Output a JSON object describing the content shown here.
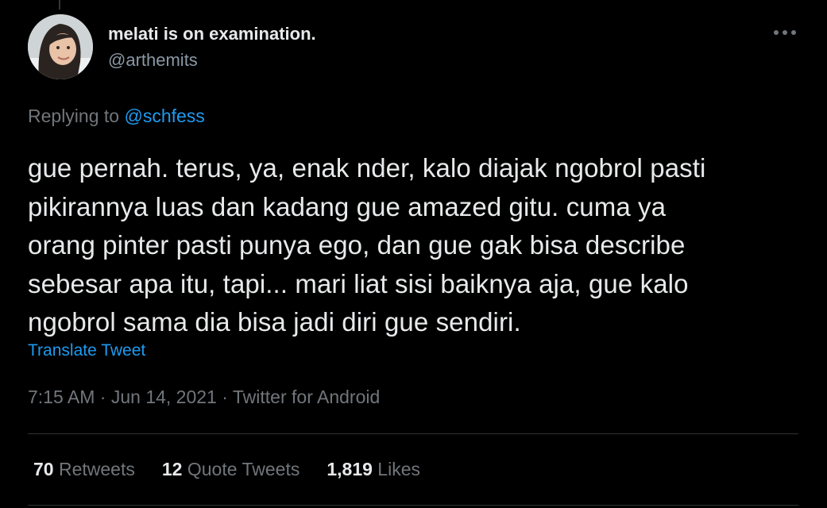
{
  "tweet": {
    "author": {
      "display_name": "melati is on examination.",
      "handle": "@arthemits",
      "avatar_icon": "child-portrait-avatar"
    },
    "more_icon": "more-dots-icon",
    "replying": {
      "prefix": "Replying to",
      "mention": "@schfess"
    },
    "text_lines": [
      "gue pernah. terus, ya, enak nder, kalo diajak ngobrol pasti",
      "pikirannya luas dan kadang gue amazed gitu. cuma ya",
      "orang pinter pasti punya ego, dan gue gak bisa describe",
      "sebesar apa itu, tapi... mari liat sisi baiknya aja, gue kalo",
      "ngobrol sama dia bisa jadi diri gue sendiri."
    ],
    "translate_label": "Translate Tweet",
    "meta": {
      "time": "7:15 AM",
      "separator": "·",
      "date": "Jun 14, 2021",
      "source": "Twitter for Android"
    },
    "stats": {
      "retweets": {
        "count": "70",
        "label": "Retweets"
      },
      "quotes": {
        "count": "12",
        "label": "Quote Tweets"
      },
      "likes": {
        "count": "1,819",
        "label": "Likes"
      }
    }
  },
  "colors": {
    "background": "#000000",
    "text": "#e7e9ea",
    "secondary": "#71767b",
    "accent": "#1d9bf0",
    "divider": "#2f3336"
  }
}
